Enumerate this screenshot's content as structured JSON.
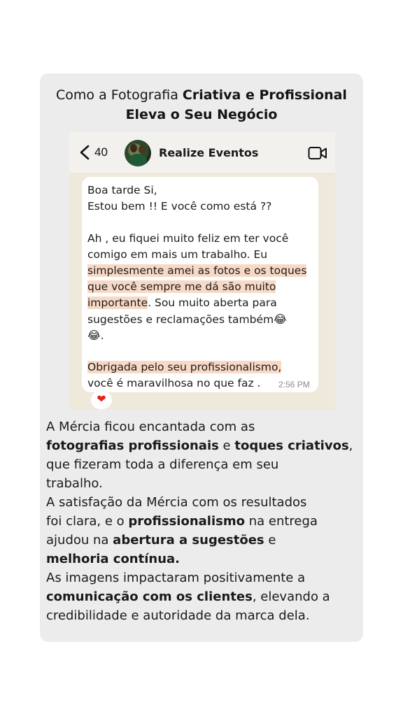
{
  "title": {
    "line1_plain": "Como a Fotografia ",
    "line1_bold": "Criativa e Profissional",
    "line2_bold": "Eleva o Seu Negócio"
  },
  "chat": {
    "back_count": "40",
    "contact_name": "Realize Eventos",
    "message_lines": [
      "Boa tarde Si,",
      "Estou bem !! E você como está ??",
      "Ah , eu fiquei muito feliz em ter você",
      "comigo em mais um trabalho. Eu",
      "simplesmente amei as fotos e os toques",
      "que você sempre me dá são muito",
      "importante",
      ". Sou muito aberta para",
      "sugestões e reclamações também",
      "😂",
      "😂",
      ".",
      "Obrigada pelo seu profissionalismo,",
      "você é maravilhosa no que faz ."
    ],
    "time": "2:56 PM",
    "reaction": "❤"
  },
  "body": {
    "p1_a": "A Mércia ficou encantada com as",
    "p1_b_bold": "fotografias profissionais",
    "p1_c": " e ",
    "p1_d_bold": "toques criativos",
    "p1_e": ",",
    "p1_f": "que fizeram toda a diferença em seu",
    "p1_g": "trabalho.",
    "p2_a": "A satisfação da Mércia com os resultados",
    "p2_b": "foi clara, e o ",
    "p2_c_bold": "profissionalismo",
    "p2_d": " na entrega",
    "p2_e": "ajudou na ",
    "p2_f_bold": "abertura a sugestões",
    "p2_g": " e",
    "p2_h_bold": "melhoria contínua.",
    "p3_a": "As imagens impactaram positivamente a",
    "p3_b_bold": "comunicação com os clientes",
    "p3_c": ", elevando a",
    "p3_d": "credibilidade e autoridade da marca dela."
  },
  "colors": {
    "card": "#ececec",
    "highlight": "#f8d9c6",
    "chat_bg": "#efe9dc",
    "heart": "#e2231a"
  },
  "icons": {
    "back": "chevron-left-icon",
    "video": "video-camera-icon",
    "reaction": "heart-icon"
  }
}
